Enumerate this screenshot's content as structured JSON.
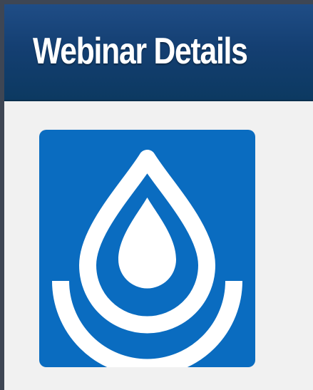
{
  "header": {
    "title": "Webinar Details"
  },
  "logo": {
    "icon": "water-drop-icon",
    "tile_color": "#0a6cc0",
    "glyph_color": "#ffffff"
  },
  "colors": {
    "header_background": "#143f72",
    "panel_background": "#f1f1f1",
    "outer_frame": "#3e4654"
  }
}
